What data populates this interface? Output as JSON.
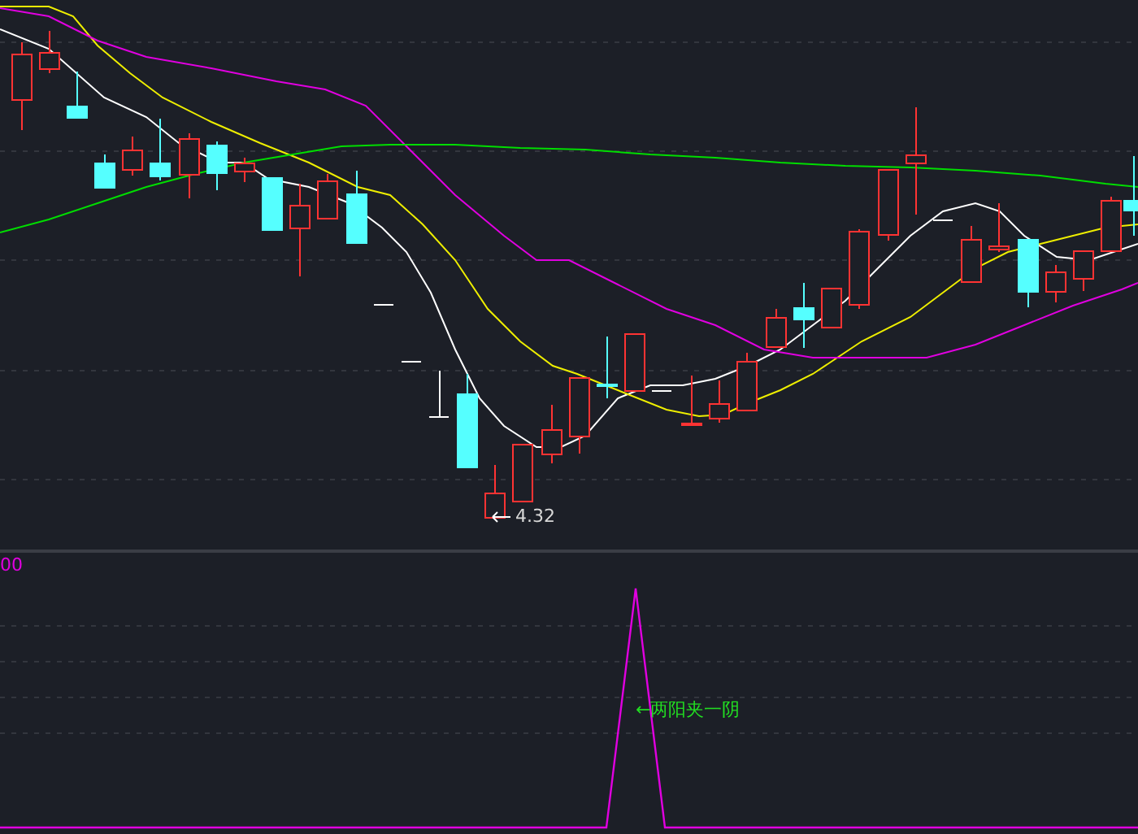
{
  "price_panel": {
    "low_label": "4.32"
  },
  "indicator_panel": {
    "value_label": "00",
    "signal_label": "←两阳夹一阴"
  }
}
